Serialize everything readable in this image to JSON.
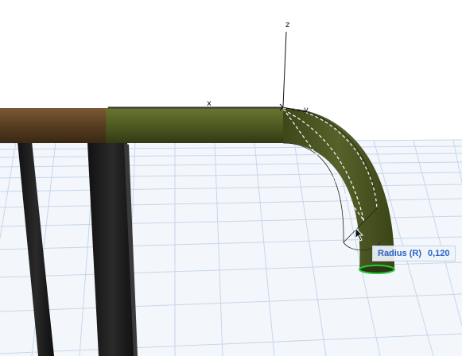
{
  "viewport": {
    "axes": {
      "x": "x",
      "y": "y",
      "z": "z"
    }
  },
  "tooltip": {
    "label": "Radius (R)",
    "value": "0,120"
  },
  "cursor": {
    "icon": "arrow-cursor-icon"
  },
  "colors": {
    "pipe_selected": "#4e5a22",
    "pipe_existing": "#5b4226",
    "post": "#1e1e1e",
    "grid_line": "#c6d6ea",
    "tooltip_text": "#2a62c8",
    "end_highlight": "#25c83a"
  }
}
